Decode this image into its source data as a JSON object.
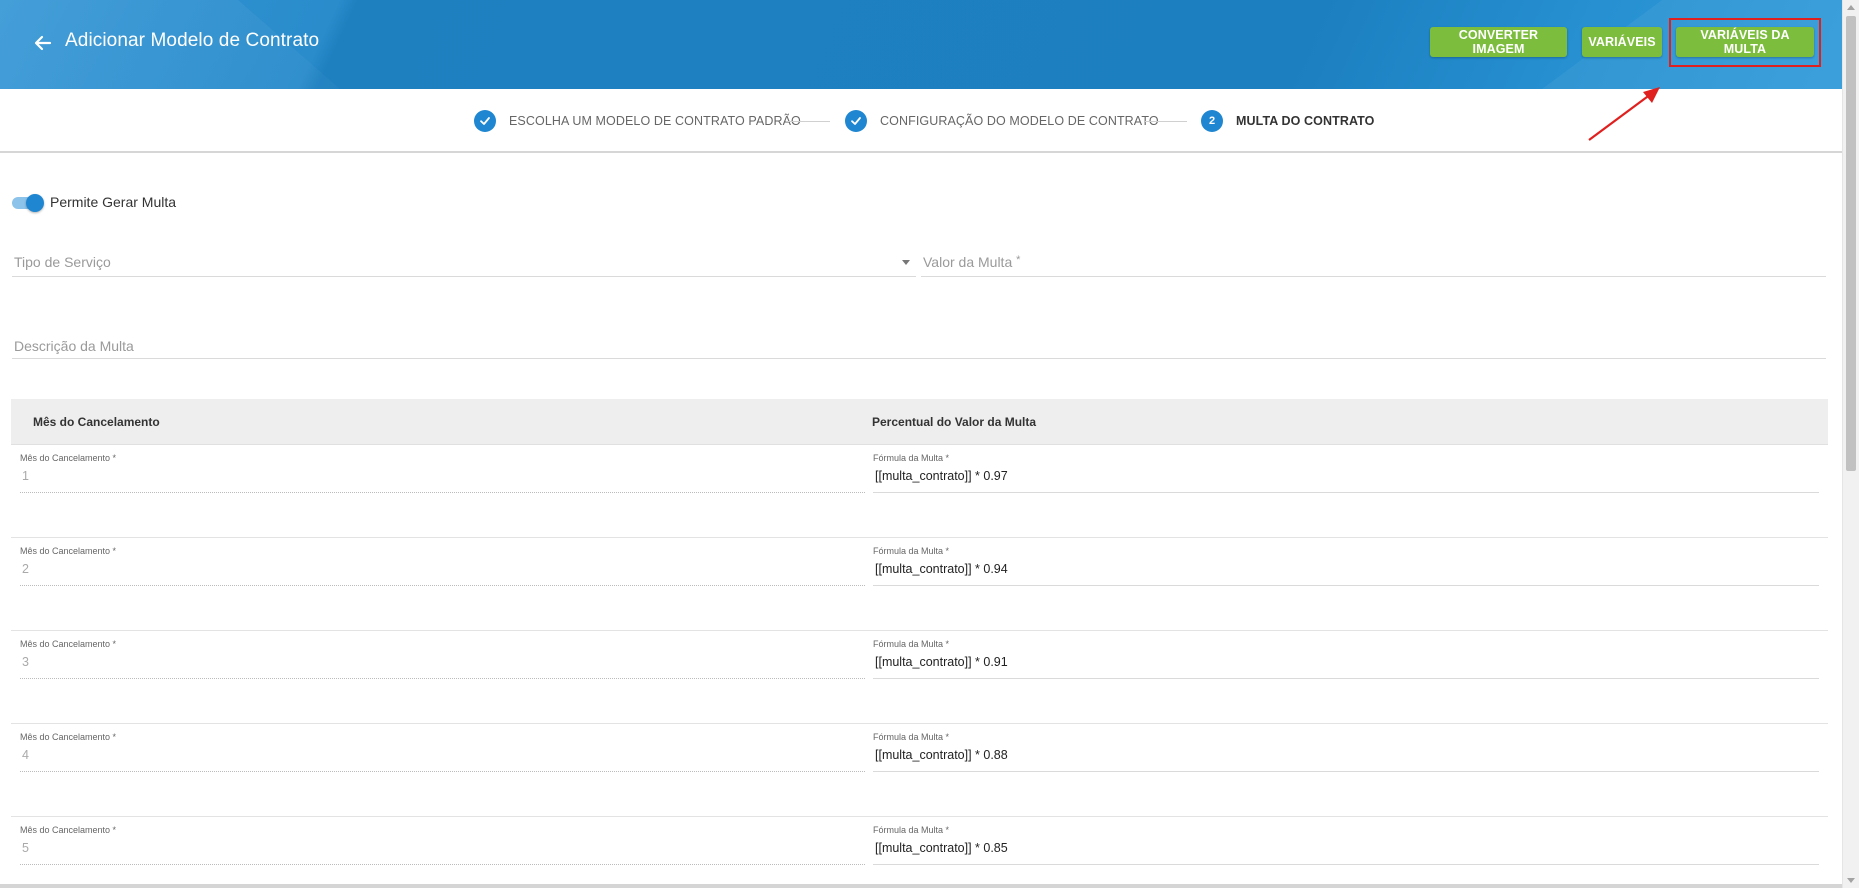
{
  "header": {
    "title": "Adicionar Modelo de Contrato",
    "back_icon": "arrow-left-icon",
    "buttons": {
      "convert_image": "CONVERTER IMAGEM",
      "variables": "VARIÁVEIS",
      "penalty_variables": "VARIÁVEIS DA MULTA"
    },
    "colors": {
      "bar": "#1c7fbf",
      "button": "#7cbd3e",
      "highlight": "#e0201e"
    }
  },
  "stepper": {
    "steps": [
      {
        "label": "ESCOLHA UM MODELO DE CONTRATO PADRÃO",
        "status": "done",
        "icon": "check-icon"
      },
      {
        "label": "CONFIGURAÇÃO DO MODELO DE CONTRATO",
        "status": "done",
        "icon": "check-icon"
      },
      {
        "label": "MULTA DO CONTRATO",
        "status": "active",
        "number": "2"
      }
    ]
  },
  "form": {
    "toggle_label": "Permite Gerar Multa",
    "toggle_on": true,
    "service_type_placeholder": "Tipo de Serviço",
    "penalty_value_placeholder": "Valor da Multa",
    "penalty_value_required": "*",
    "description_placeholder": "Descrição da Multa"
  },
  "table": {
    "headers": {
      "month": "Mês do Cancelamento",
      "percent": "Percentual do Valor da Multa"
    },
    "month_label": "Mês do Cancelamento *",
    "formula_label": "Fórmula da Multa *",
    "rows": [
      {
        "month": "1",
        "formula": "[[multa_contrato]] * 0.97"
      },
      {
        "month": "2",
        "formula": "[[multa_contrato]] * 0.94"
      },
      {
        "month": "3",
        "formula": "[[multa_contrato]] * 0.91"
      },
      {
        "month": "4",
        "formula": "[[multa_contrato]] * 0.88"
      },
      {
        "month": "5",
        "formula": "[[multa_contrato]] * 0.85"
      }
    ]
  }
}
